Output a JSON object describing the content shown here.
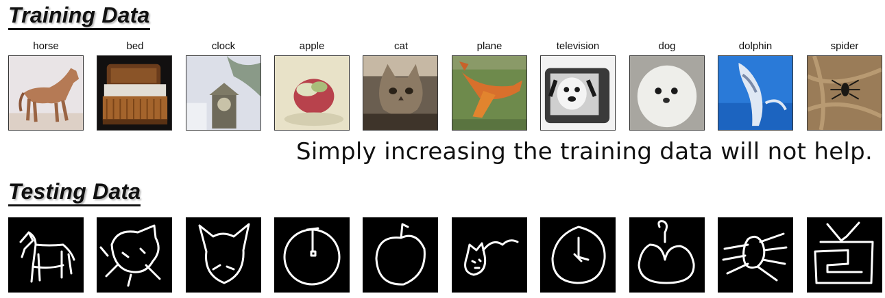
{
  "training": {
    "title": "Training Data",
    "labels": [
      "horse",
      "bed",
      "clock",
      "apple",
      "cat",
      "plane",
      "television",
      "dog",
      "dolphin",
      "spider"
    ]
  },
  "note": "Simply increasing the training data will not help.",
  "testing": {
    "title": "Testing Data"
  },
  "colors": {
    "text": "#111111",
    "sketch_bg": "#000000",
    "sketch_stroke": "#ffffff"
  }
}
